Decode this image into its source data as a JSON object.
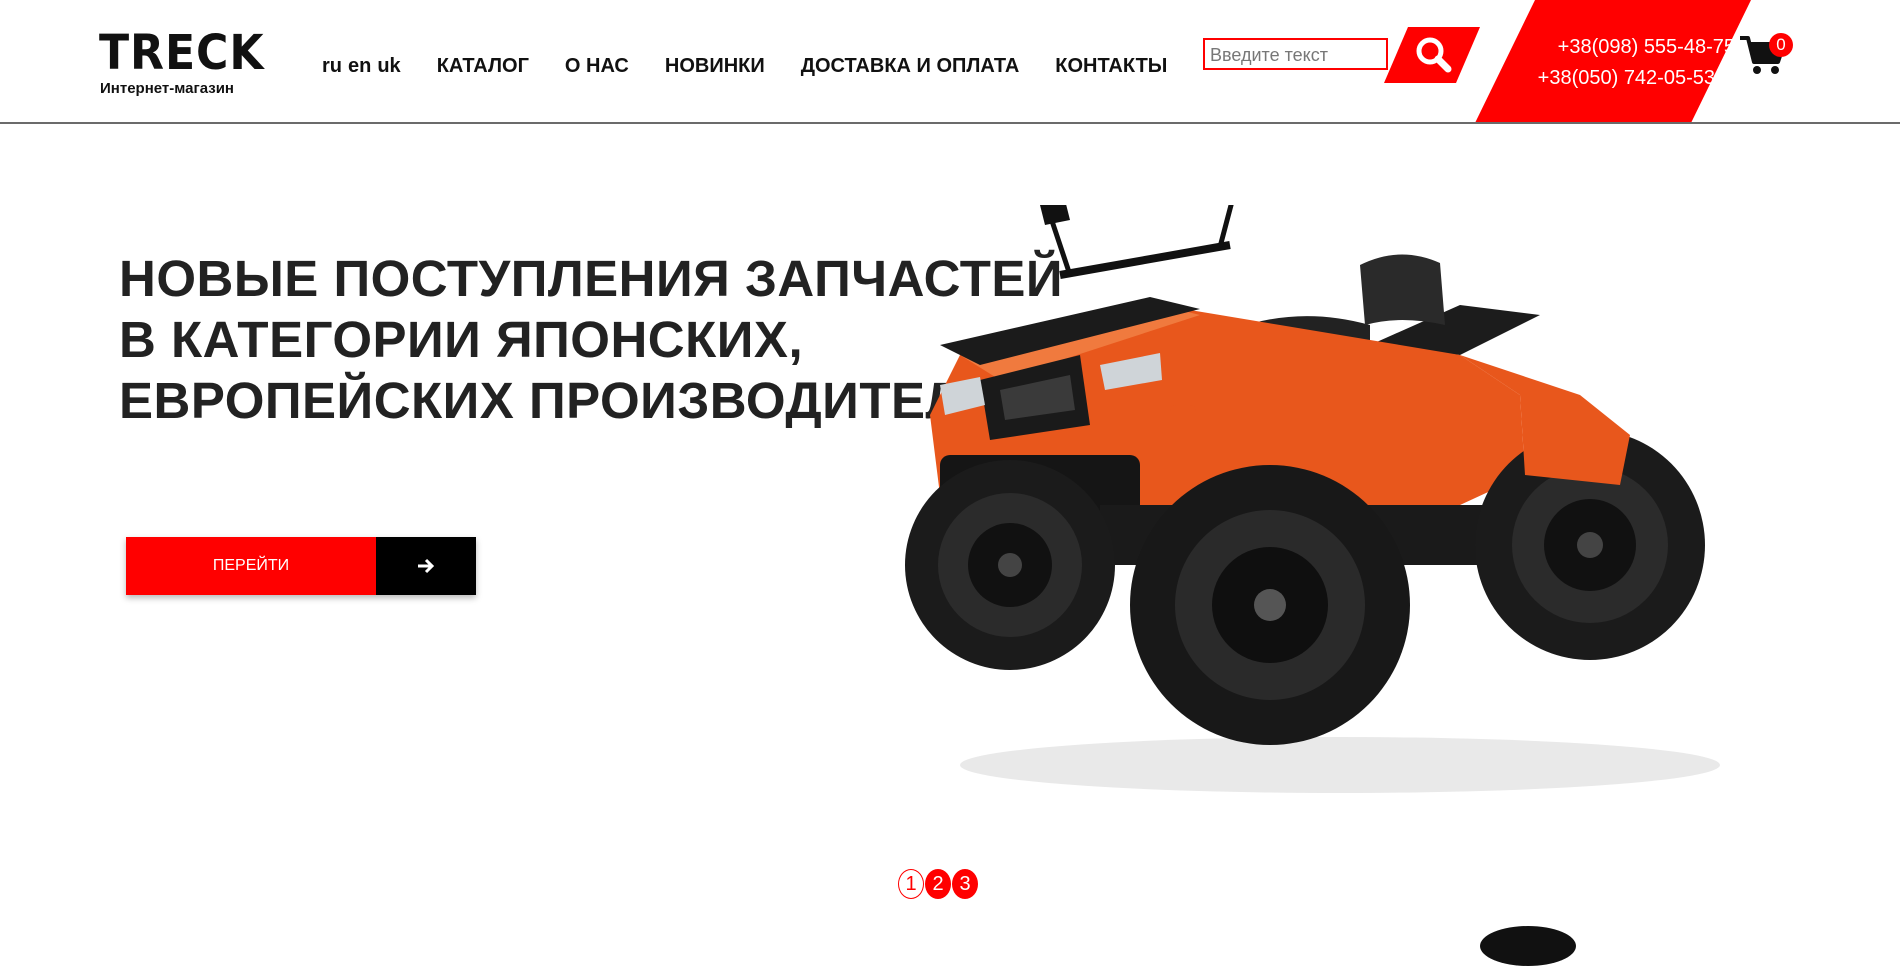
{
  "header": {
    "logo": {
      "word": "TRECK",
      "subtitle": "Интернет-магазин"
    },
    "languages": [
      "ru",
      "en",
      "uk"
    ],
    "menu": [
      "КАТАЛОГ",
      "О НАС",
      "НОВИНКИ",
      "ДОСТАВКА И ОПЛАТА",
      "КОНТАКТЫ"
    ],
    "search": {
      "placeholder": "Введите текст",
      "value": ""
    },
    "phones": [
      "+38(098) 555-48-75",
      "+38(050) 742-05-53"
    ],
    "cart_count": "0"
  },
  "hero": {
    "title_lines": [
      "НОВЫЕ ПОСТУПЛЕНИЯ ЗАПЧАСТЕЙ",
      "В КАТЕГОРИИ ЯПОНСКИХ,",
      "ЕВРОПЕЙСКИХ ПРОИЗВОДИТЕЛЕЙ"
    ],
    "cta_label": "ПЕРЕЙТИ",
    "slides": [
      "1",
      "2",
      "3"
    ],
    "active_slide": 1
  },
  "colors": {
    "accent": "#ff0000",
    "text": "#222222",
    "dark": "#000000",
    "atv_body": "#e8571c"
  },
  "icons": [
    "search-icon",
    "cart-icon",
    "arrow-right-icon"
  ]
}
